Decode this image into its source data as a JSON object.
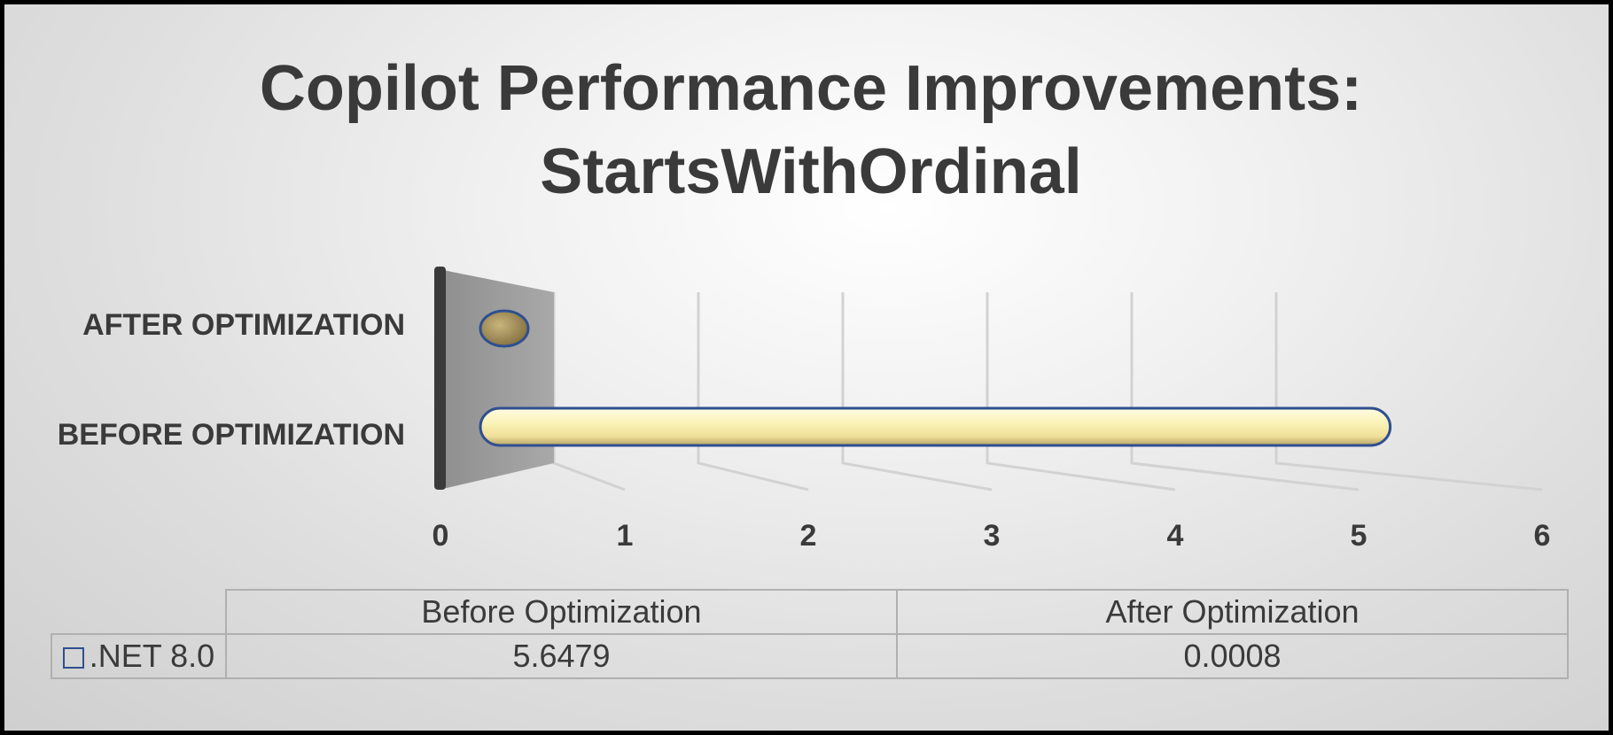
{
  "chart_data": {
    "type": "bar",
    "orientation": "horizontal",
    "title_lines": [
      "Copilot Performance Improvements:",
      "StartsWithOrdinal"
    ],
    "categories": [
      "Before Optimization",
      "After Optimization"
    ],
    "category_axis_labels": [
      "AFTER OPTIMIZATION",
      "BEFORE OPTIMIZATION"
    ],
    "series": [
      {
        "name": ".NET 8.0",
        "values": [
          5.6479,
          0.0008
        ],
        "color": "#fbf3b8",
        "outline": "#2f4f8f"
      }
    ],
    "xlim": [
      0,
      6
    ],
    "xticks": [
      "0",
      "1",
      "2",
      "3",
      "4",
      "5",
      "6"
    ],
    "grid": true,
    "legend": "data-table"
  },
  "table": {
    "headers": [
      "Before Optimization",
      "After Optimization"
    ],
    "row_label": ".NET 8.0",
    "row_values": [
      "5.6479",
      "0.0008"
    ]
  },
  "colors": {
    "bar_fill": "#fbf3b8",
    "bar_outline": "#2f4f8f",
    "text": "#3a3a3a"
  }
}
